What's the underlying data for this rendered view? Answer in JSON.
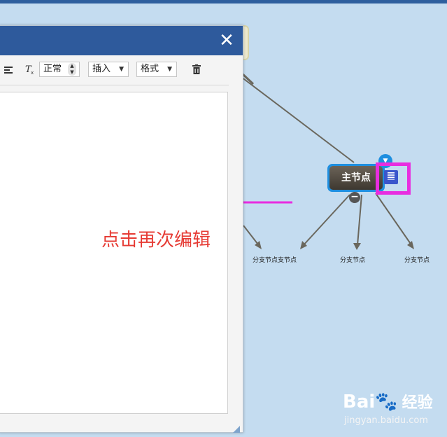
{
  "dialog": {
    "close_glyph": "✕",
    "toolbar": {
      "align_icon": "align-left-icon",
      "clear_format_icon": "clear-format-icon",
      "paragraph_select": "正常",
      "insert_menu": "插入",
      "format_menu": "格式",
      "delete_icon": "trash-icon"
    }
  },
  "mindmap": {
    "main_node": "主节点",
    "collapse_glyph": "−",
    "expand_glyph": "▼",
    "note_icon": "note-icon",
    "branches": [
      "分支节点支节点",
      "分支节点",
      "分支节点"
    ]
  },
  "annotation": "点击再次编辑",
  "colors": {
    "accent": "#2e5a9c",
    "annotation_text": "#e63b34",
    "highlight": "#e82de0",
    "node_border": "#1e8fe0"
  },
  "watermark": {
    "brand": "Bai",
    "brand_right": "经验",
    "url": "jingyan.baidu.com"
  }
}
